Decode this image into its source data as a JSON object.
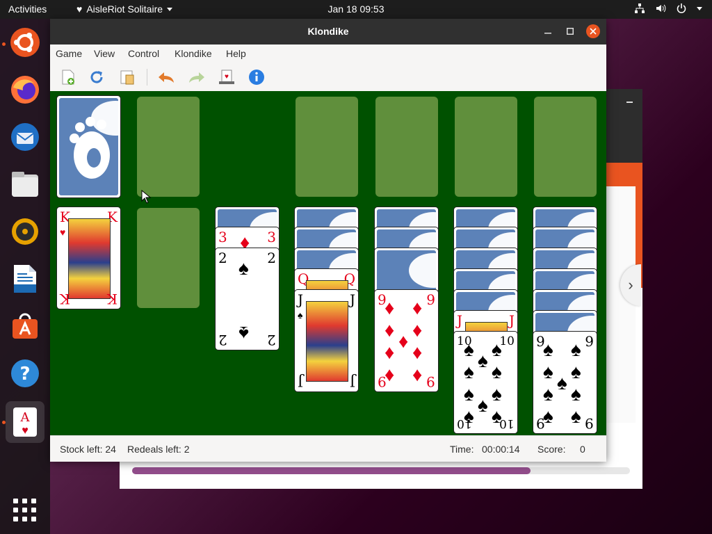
{
  "topbar": {
    "activities": "Activities",
    "app_name": "AisleRiot Solitaire",
    "clock": "Jan 18  09:53"
  },
  "dock": {
    "items": [
      {
        "name": "Ubuntu Software logo",
        "icon": "ubuntu-icon"
      },
      {
        "name": "Firefox",
        "icon": "firefox-icon"
      },
      {
        "name": "Thunderbird",
        "icon": "thunderbird-icon"
      },
      {
        "name": "Files",
        "icon": "files-icon"
      },
      {
        "name": "Rhythmbox",
        "icon": "rhythmbox-icon"
      },
      {
        "name": "LibreOffice Writer",
        "icon": "writer-icon"
      },
      {
        "name": "Ubuntu Software",
        "icon": "software-icon"
      },
      {
        "name": "Help",
        "icon": "help-icon"
      },
      {
        "name": "AisleRiot Solitaire",
        "icon": "solitaire-icon"
      }
    ]
  },
  "window": {
    "title": "Klondike",
    "menu": [
      "Game",
      "View",
      "Control",
      "Klondike",
      "Help"
    ]
  },
  "cards": {
    "king": "K",
    "three": "3",
    "two": "2",
    "queen": "Q",
    "jack": "J",
    "nine": "9",
    "ten": "10",
    "heart": "♥",
    "diamond": "♦",
    "spade": "♠"
  },
  "statusbar": {
    "stock": "Stock left: 24",
    "redeals": "Redeals left: 2",
    "time_label": "Time:",
    "time_value": "00:00:14",
    "score_label": "Score:",
    "score_value": "0"
  },
  "colors": {
    "felt": "#005100",
    "slot": "#6a9642",
    "card_back": "#5c82b8",
    "accent": "#e95420"
  }
}
